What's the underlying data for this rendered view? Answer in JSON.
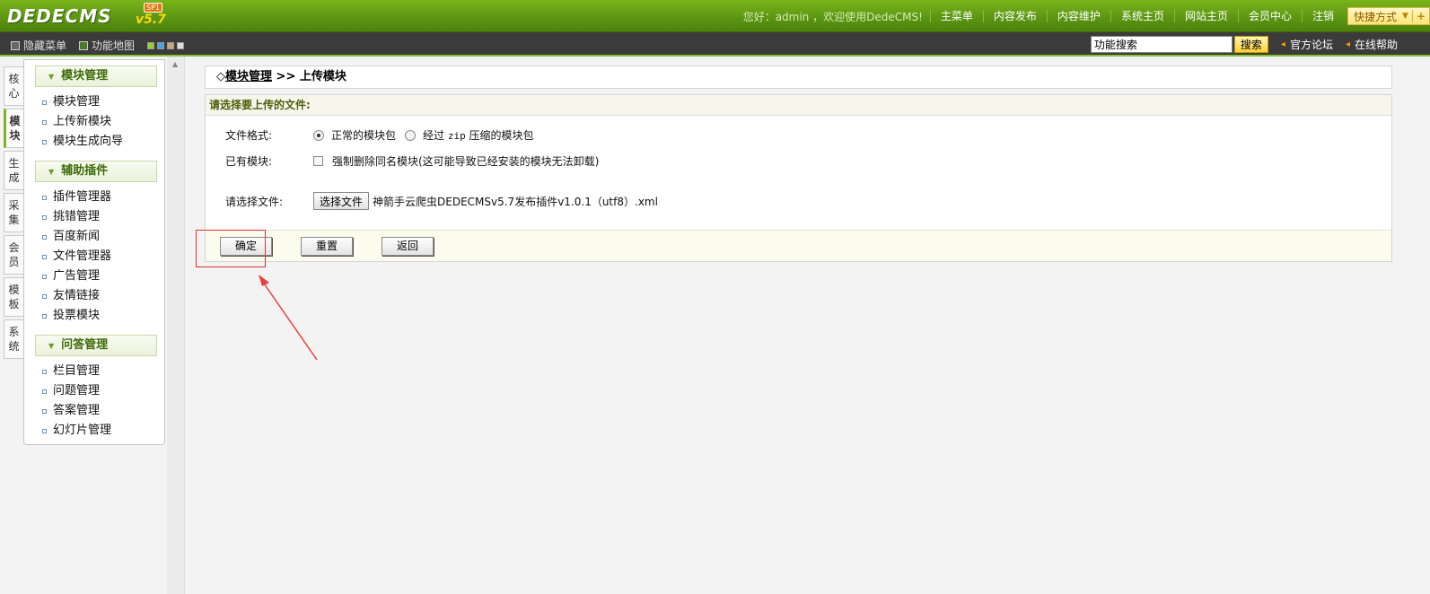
{
  "header": {
    "logo_text": "DEDECMS",
    "logo_version": "v5.7",
    "logo_badge": "SP1",
    "welcome": "您好：admin ，欢迎使用DedeCMS!",
    "nav": [
      "主菜单",
      "内容发布",
      "内容维护",
      "系统主页",
      "网站主页",
      "会员中心",
      "注销"
    ],
    "quick_label": "快捷方式",
    "quick_plus": "+"
  },
  "subbar": {
    "hide_menu": "隐藏菜单",
    "site_map": "功能地图",
    "skin_colors": [
      "#9acd32",
      "#4aa3df",
      "#c8a878",
      "#dddddd"
    ],
    "search_value": "功能搜索",
    "search_button": "搜索",
    "forum_link": "官方论坛",
    "help_link": "在线帮助"
  },
  "vtabs": [
    "核心",
    "模块",
    "生成",
    "采集",
    "会员",
    "模板",
    "系统"
  ],
  "vtab_active": "模块",
  "menu": {
    "sections": [
      {
        "title": "模块管理",
        "items": [
          "模块管理",
          "上传新模块",
          "模块生成向导"
        ]
      },
      {
        "title": "辅助插件",
        "items": [
          "插件管理器",
          "挑错管理",
          "百度新闻",
          "文件管理器",
          "广告管理",
          "友情链接",
          "投票模块"
        ]
      },
      {
        "title": "问答管理",
        "items": [
          "栏目管理",
          "问题管理",
          "答案管理",
          "幻灯片管理"
        ]
      }
    ]
  },
  "breadcrumb": {
    "prefix": "◇",
    "link": "模块管理",
    "separator": ">>",
    "current": "上传模块"
  },
  "form": {
    "title": "请选择要上传的文件:",
    "format_label": "文件格式:",
    "format_options": [
      "正常的模块包",
      "经过 zip 压缩的模块包"
    ],
    "format_selected": "正常的模块包",
    "zip_word": "zip",
    "existing_label": "已有模块:",
    "force_delete_text": "强制删除同名模块(这可能导致已经安装的模块无法卸载)",
    "force_delete_checked": false,
    "file_label": "请选择文件:",
    "file_button": "选择文件",
    "file_name": "神箭手云爬虫DEDECMSv5.7发布插件v1.0.1（utf8）.xml",
    "buttons": [
      "确定",
      "重置",
      "返回"
    ]
  },
  "icons": {
    "hide_menu": "menu-toggle-icon",
    "site_map": "grid-icon",
    "menu_head": "triangle-down-icon",
    "ext_link": "signal-icon"
  }
}
